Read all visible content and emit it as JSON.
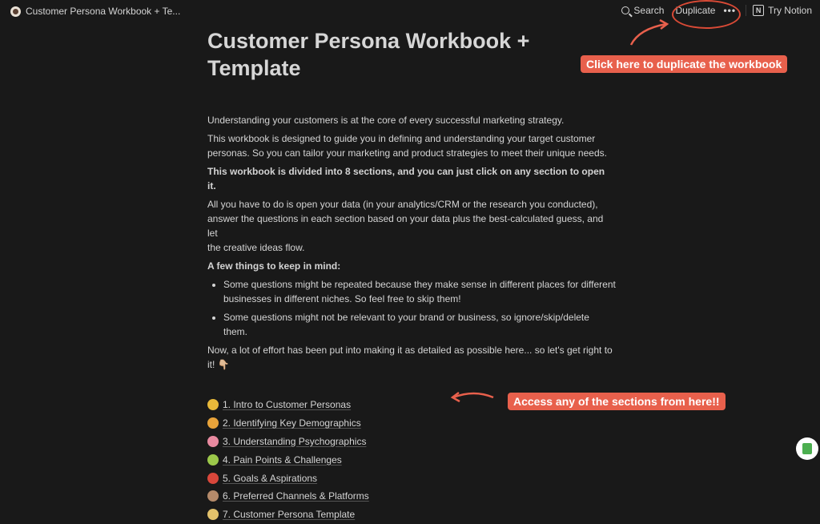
{
  "topbar": {
    "page_title": "Customer Persona Workbook + Te...",
    "search_label": "Search",
    "duplicate_label": "Duplicate",
    "more_label": "•••",
    "try_notion_label": "Try Notion",
    "notion_icon": "N"
  },
  "page": {
    "title_line1": "Customer Persona Workbook +",
    "title_line2": "Template",
    "intro": "Understanding your customers is at the core of every successful marketing strategy.",
    "p2_line1": "This workbook is designed to guide you in defining and understanding your target customer",
    "p2_line2": "personas. So you can tailor your marketing and product strategies to meet their unique needs.",
    "p3": "This workbook is divided into 8 sections, and you can just click on any section to open it.",
    "p4_line1": "All you have to do is open your data (in your analytics/CRM or the research you conducted),",
    "p4_line2": "answer the questions in each section based on your data plus the best-calculated guess, and let",
    "p4_line3": "the creative ideas flow.",
    "p5": "A few things to keep in mind:",
    "bullet1_line1": "Some questions might be repeated because they make sense in different places for different",
    "bullet1_line2": "businesses in different niches. So feel free to skip them!",
    "bullet2": "Some questions might not be relevant to your brand or business, so ignore/skip/delete them.",
    "p6_line1": "Now, a lot of effort has been put into making it as detailed as possible here... so let's get right to",
    "p6_line2": "it! 👇🏼"
  },
  "sections": [
    {
      "label": "1. Intro to Customer Personas",
      "icon": "thinking-face-icon",
      "color": "#e8b93a"
    },
    {
      "label": "2. Identifying Key Demographics",
      "icon": "nerd-face-icon",
      "color": "#e8a33a"
    },
    {
      "label": "3. Understanding Psychographics",
      "icon": "brain-icon",
      "color": "#e98aa0"
    },
    {
      "label": "4. Pain Points & Challenges",
      "icon": "nauseated-face-icon",
      "color": "#9cc84a"
    },
    {
      "label": "5. Goals & Aspirations",
      "icon": "target-icon",
      "color": "#d9473b"
    },
    {
      "label": "6. Preferred Channels & Platforms",
      "icon": "phone-icon",
      "color": "#b58a6a"
    },
    {
      "label": "7. Customer Persona Template",
      "icon": "memo-icon",
      "color": "#e2c16b"
    }
  ],
  "annotations": {
    "duplicate_note": "Click here to duplicate the workbook",
    "sections_note": "Access any of the sections from here!!",
    "accent": "#e8604c"
  }
}
